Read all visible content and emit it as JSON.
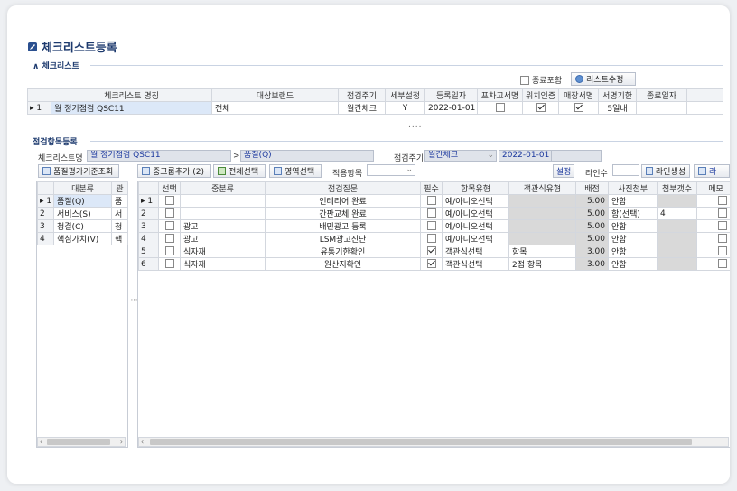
{
  "title": "체크리스트등록",
  "checklist_section": {
    "label": "체크리스트",
    "toggle": "∧",
    "end_include_label": "종료포함",
    "list_edit_label": "리스트수정",
    "columns": [
      "체크리스트 명칭",
      "대상브랜드",
      "점검주기",
      "세부설정",
      "등록일자",
      "프차고서명",
      "위치인증",
      "매장서명",
      "서명기한",
      "종료일자"
    ],
    "row": {
      "index": "▸ 1",
      "name": "월 정기점검 QSC11",
      "brand": "전체",
      "cycle": "월간체크",
      "detail": "Y",
      "date": "2022-01-01",
      "sign_limit": "5일내"
    }
  },
  "splitter_dots": "....",
  "items_section": {
    "label": "점검항목등록",
    "checklist_name_label": "체크리스트명",
    "checklist_name_value": "월 정기점검 QSC11",
    "arrow": ">",
    "category_value": "품질(Q)",
    "cycle_label": "점검주기",
    "cycle_value": "월간체크",
    "date_value": "2022-01-01"
  },
  "left_panel": {
    "button": "품질평가기준조회",
    "columns": [
      "대분류",
      "관"
    ],
    "rows": [
      {
        "idx": "▸ 1",
        "name": "품질(Q)",
        "extra": "품"
      },
      {
        "idx": "2",
        "name": "서비스(S)",
        "extra": "서"
      },
      {
        "idx": "3",
        "name": "청결(C)",
        "extra": "청"
      },
      {
        "idx": "4",
        "name": "핵심가치(V)",
        "extra": "핵"
      }
    ]
  },
  "toolbar": {
    "add_group": "중그룹추가 (2)",
    "select_all": "전체선택",
    "area_select": "영역선택",
    "apply_item": "적용항목",
    "settings": "설정",
    "line_count": "라인수",
    "line_create": "라인생성",
    "more": "라"
  },
  "main_grid": {
    "columns": [
      "선택",
      "중분류",
      "점검질문",
      "필수",
      "항목유형",
      "객관식유형",
      "배점",
      "사진첨부",
      "첨부갯수",
      "메모"
    ],
    "rows": [
      {
        "idx": "▸ 1",
        "mid": "",
        "q": "인테리어 완료",
        "req": false,
        "type": "예/아니오선택",
        "obj": "",
        "score": "5.00",
        "photo": "안함",
        "cnt": ""
      },
      {
        "idx": "2",
        "mid": "",
        "q": "간판교체 완료",
        "req": false,
        "type": "예/아니오선택",
        "obj": "",
        "score": "5.00",
        "photo": "함(선택)",
        "cnt": "4"
      },
      {
        "idx": "3",
        "mid": "광고",
        "q": "배민광고 등록",
        "req": false,
        "type": "예/아니오선택",
        "obj": "",
        "score": "5.00",
        "photo": "안함",
        "cnt": ""
      },
      {
        "idx": "4",
        "mid": "광고",
        "q": "LSM광고진단",
        "req": false,
        "type": "예/아니오선택",
        "obj": "",
        "score": "5.00",
        "photo": "안함",
        "cnt": ""
      },
      {
        "idx": "5",
        "mid": "식자재",
        "q": "유통기한확인",
        "req": true,
        "type": "객관식선택",
        "obj": "항목",
        "score": "3.00",
        "photo": "안함",
        "cnt": ""
      },
      {
        "idx": "6",
        "mid": "식자재",
        "q": "원산지확인",
        "req": true,
        "type": "객관식선택",
        "obj": "2점 항목",
        "score": "3.00",
        "photo": "안함",
        "cnt": ""
      }
    ]
  }
}
